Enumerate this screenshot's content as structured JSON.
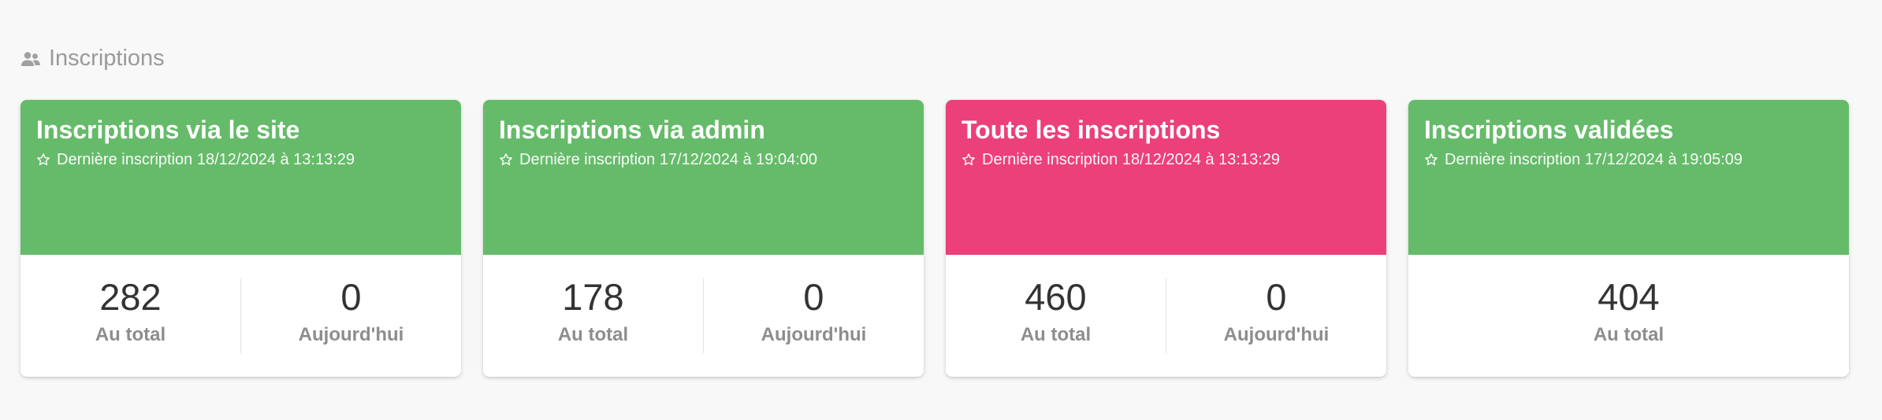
{
  "section": {
    "title": "Inscriptions",
    "icon": "people-icon"
  },
  "cards": [
    {
      "title": "Inscriptions via le site",
      "subtitle": "Dernière inscription 18/12/2024 à 13:13:29",
      "color": "#66bb6a",
      "stats": [
        {
          "value": "282",
          "label": "Au total"
        },
        {
          "value": "0",
          "label": "Aujourd'hui"
        }
      ]
    },
    {
      "title": "Inscriptions via admin",
      "subtitle": "Dernière inscription 17/12/2024 à 19:04:00",
      "color": "#66bb6a",
      "stats": [
        {
          "value": "178",
          "label": "Au total"
        },
        {
          "value": "0",
          "label": "Aujourd'hui"
        }
      ]
    },
    {
      "title": "Toute les inscriptions",
      "subtitle": "Dernière inscription 18/12/2024 à 13:13:29",
      "color": "#ec407a",
      "stats": [
        {
          "value": "460",
          "label": "Au total"
        },
        {
          "value": "0",
          "label": "Aujourd'hui"
        }
      ]
    },
    {
      "title": "Inscriptions validées",
      "subtitle": "Dernière inscription 17/12/2024 à 19:05:09",
      "color": "#66bb6a",
      "stats": [
        {
          "value": "404",
          "label": "Au total"
        }
      ]
    }
  ]
}
